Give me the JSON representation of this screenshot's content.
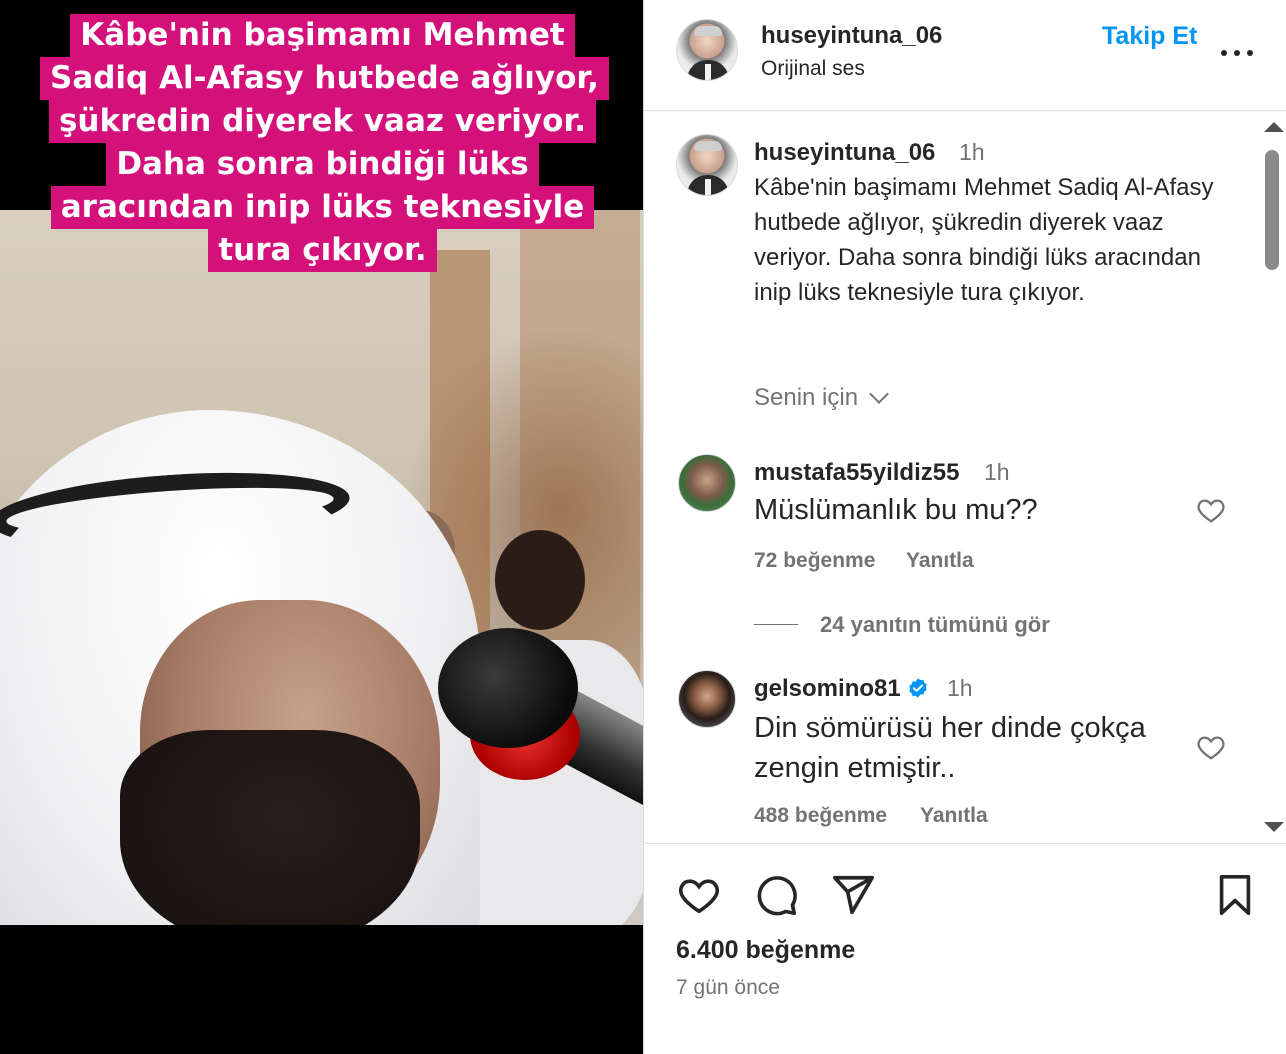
{
  "post": {
    "overlay_caption_lines": [
      "Kâbe'nin başimamı Mehmet",
      "Sadiq Al-Afasy hutbede ağlıyor,",
      "şükredin diyerek vaaz veriyor.",
      "Daha sonra bindiği lüks",
      "aracından inip lüks teknesiyle",
      "tura çıkıyor."
    ]
  },
  "header": {
    "username": "huseyintuna_06",
    "audio": "Orijinal ses",
    "follow_label": "Takip Et",
    "more_icon": "more-horizontal-icon"
  },
  "caption": {
    "username": "huseyintuna_06",
    "time": "1h",
    "text": "Kâbe'nin başimamı Mehmet Sadiq Al-Afasy hutbede ağlıyor, şükredin diyerek vaaz veriyor. Daha sonra bindiği lüks aracından inip lüks teknesiyle tura çıkıyor.",
    "filter_label": "Senin için"
  },
  "comments": [
    {
      "username": "mustafa55yildiz55",
      "time": "1h",
      "text": "Müslümanlık bu mu??",
      "likes": "72 beğenme",
      "reply_label": "Yanıtla",
      "view_replies": "24 yanıtın tümünü gör",
      "verified": false
    },
    {
      "username": "gelsomino81",
      "time": "1h",
      "text": "Din sömürüsü her dinde çokça zengin etmiştir..",
      "likes": "488 beğenme",
      "reply_label": "Yanıtla",
      "verified": true
    }
  ],
  "actions": {
    "likes": "6.400 beğenme",
    "posted": "7 gün önce",
    "icons": [
      "heart-icon",
      "comment-icon",
      "share-icon",
      "bookmark-icon"
    ]
  },
  "colors": {
    "accent": "#0095f6",
    "overlay_caption_bg": "#d4117a",
    "muted": "#737373",
    "verified": "#0095f6"
  }
}
